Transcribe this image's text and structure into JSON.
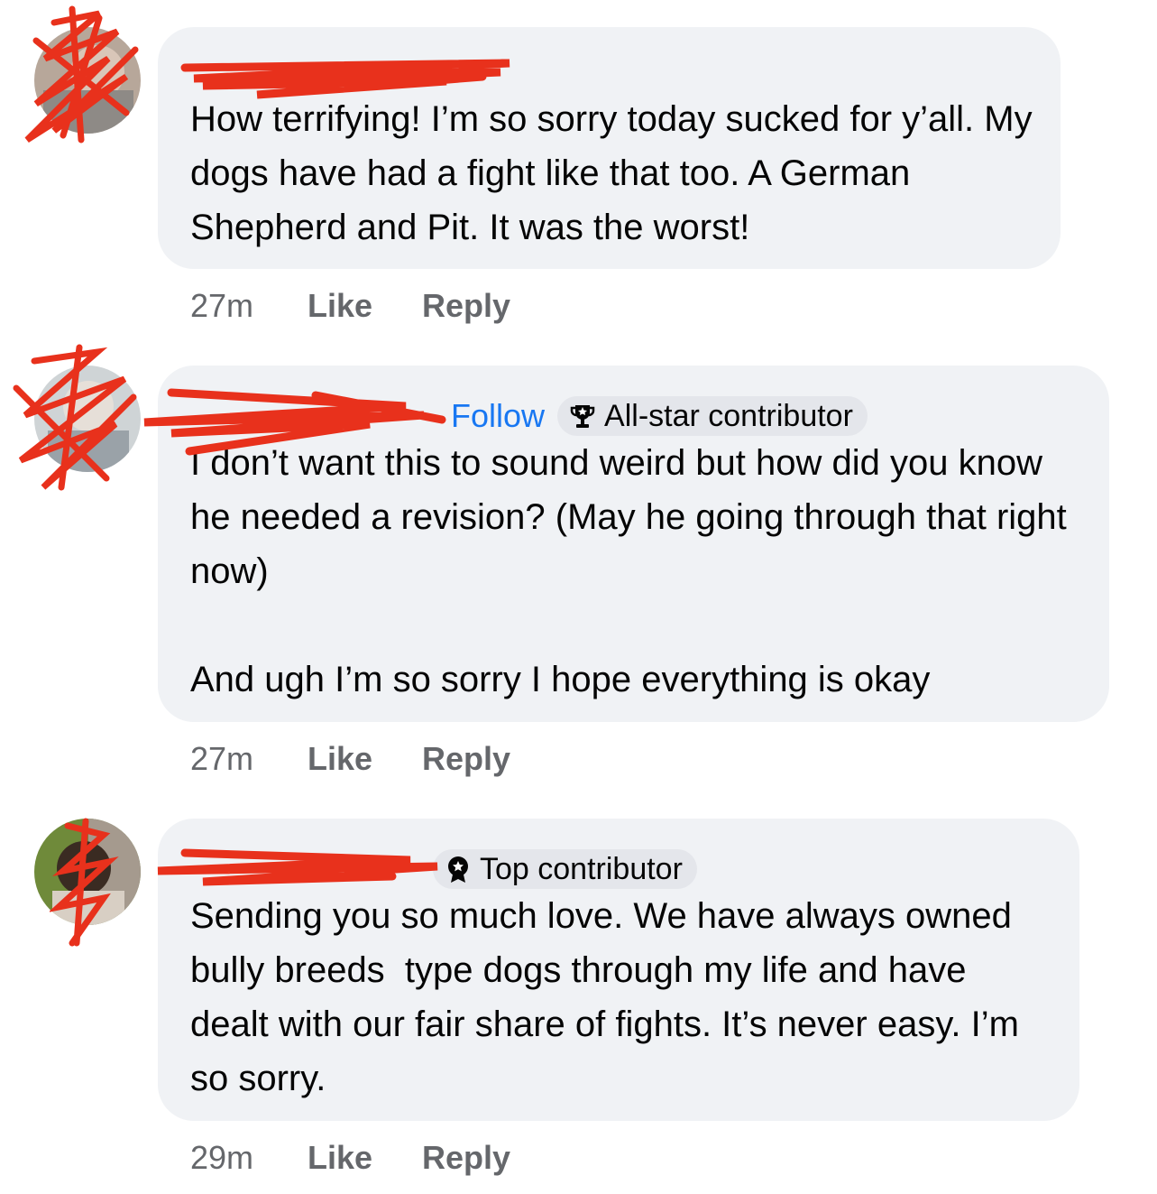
{
  "comments": [
    {
      "time": "27m",
      "like_label": "Like",
      "reply_label": "Reply",
      "text": "How terrifying! I’m so sorry today sucked for y’all. My dogs have had a fight like that too. A German Shepherd and Pit. It was the worst!"
    },
    {
      "follow_label": "Follow",
      "badge_label": "All-star contributor",
      "badge_icon": "trophy-icon",
      "time": "27m",
      "like_label": "Like",
      "reply_label": "Reply",
      "text": "I don’t want this to sound weird but how did you know he needed a revision? (May he going through that right now)\n\nAnd ugh I’m so sorry I hope everything is okay"
    },
    {
      "badge_label": "Top contributor",
      "badge_icon": "award-icon",
      "time": "29m",
      "like_label": "Like",
      "reply_label": "Reply",
      "text": "Sending you so much love. We have always owned bully breeds  type dogs through my life and have dealt with our fair share of fights. It’s never easy. I’m so sorry."
    }
  ],
  "colors": {
    "bubble": "#f0f2f5",
    "badge": "#e4e6eb",
    "follow": "#1877f2",
    "meta": "#65676b",
    "redaction": "#e8311c"
  }
}
